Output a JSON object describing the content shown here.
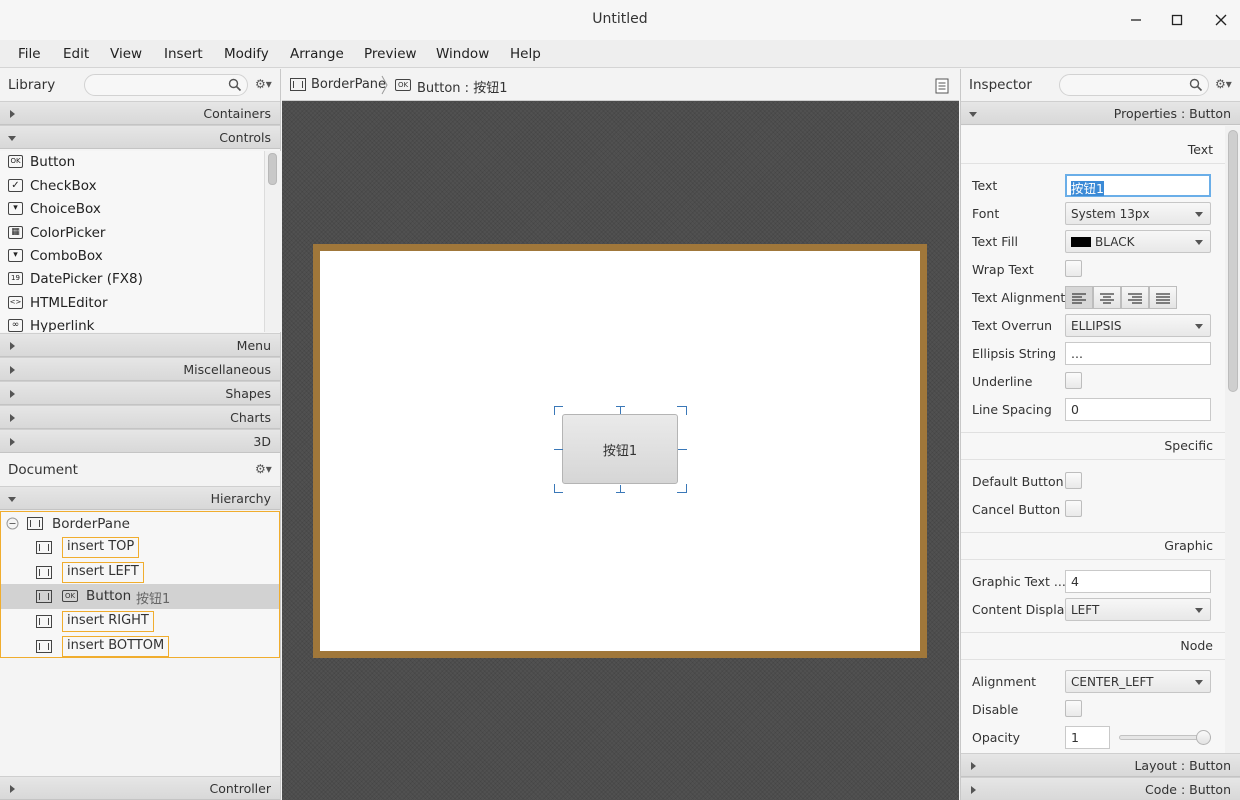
{
  "window": {
    "title": "Untitled"
  },
  "menubar": [
    "File",
    "Edit",
    "View",
    "Insert",
    "Modify",
    "Arrange",
    "Preview",
    "Window",
    "Help"
  ],
  "library": {
    "title": "Library",
    "sections_top": [
      "Containers",
      "Controls"
    ],
    "controls": [
      {
        "label": "Button",
        "icon": "button-icon",
        "glyph": "OK"
      },
      {
        "label": "CheckBox",
        "icon": "checkbox-icon",
        "glyph": "✓"
      },
      {
        "label": "ChoiceBox",
        "icon": "choicebox-icon",
        "glyph": "▾"
      },
      {
        "label": "ColorPicker",
        "icon": "colorpicker-icon",
        "glyph": "▦"
      },
      {
        "label": "ComboBox",
        "icon": "combobox-icon",
        "glyph": "▾"
      },
      {
        "label": "DatePicker  (FX8)",
        "icon": "datepicker-icon",
        "glyph": "19"
      },
      {
        "label": "HTMLEditor",
        "icon": "htmleditor-icon",
        "glyph": "<>"
      },
      {
        "label": "Hyperlink",
        "icon": "hyperlink-icon",
        "glyph": "∞"
      }
    ],
    "sections_bottom": [
      "Menu",
      "Miscellaneous",
      "Shapes",
      "Charts",
      "3D"
    ]
  },
  "document": {
    "title": "Document",
    "hierarchy_label": "Hierarchy",
    "root": "BorderPane",
    "items": [
      "insert TOP",
      "insert LEFT",
      "insert RIGHT",
      "insert BOTTOM"
    ],
    "selected": {
      "type": "Button",
      "text": "按钮1"
    },
    "controller_label": "Controller"
  },
  "breadcrumb": {
    "root": "BorderPane",
    "child": "Button : 按钮1"
  },
  "canvas": {
    "button_text": "按钮1"
  },
  "inspector": {
    "title": "Inspector",
    "properties_header": "Properties : Button",
    "sections": {
      "text": "Text",
      "specific": "Specific",
      "graphic": "Graphic",
      "node": "Node"
    },
    "text": {
      "text_label": "Text",
      "text_value": "按钮1",
      "font_label": "Font",
      "font_value": "System 13px",
      "fill_label": "Text Fill",
      "fill_value": "BLACK",
      "wrap_label": "Wrap Text",
      "alignment_label": "Text Alignment",
      "overrun_label": "Text Overrun",
      "overrun_value": "ELLIPSIS",
      "ellipsis_label": "Ellipsis String",
      "ellipsis_value": "...",
      "underline_label": "Underline",
      "spacing_label": "Line Spacing",
      "spacing_value": "0"
    },
    "specific": {
      "default_label": "Default Button",
      "cancel_label": "Cancel Button"
    },
    "graphic": {
      "gap_label": "Graphic Text ...",
      "gap_value": "4",
      "display_label": "Content Display",
      "display_value": "LEFT"
    },
    "node": {
      "alignment_label": "Alignment",
      "alignment_value": "CENTER_LEFT",
      "disable_label": "Disable",
      "opacity_label": "Opacity",
      "opacity_value": "1"
    },
    "opacity_slider": 1.0,
    "layout_label": "Layout : Button",
    "code_label": "Code : Button"
  },
  "colors": {
    "accent": "#f0ad2e",
    "pane_border": "#a0773a",
    "selection_text_bg": "#3b8ad6"
  }
}
